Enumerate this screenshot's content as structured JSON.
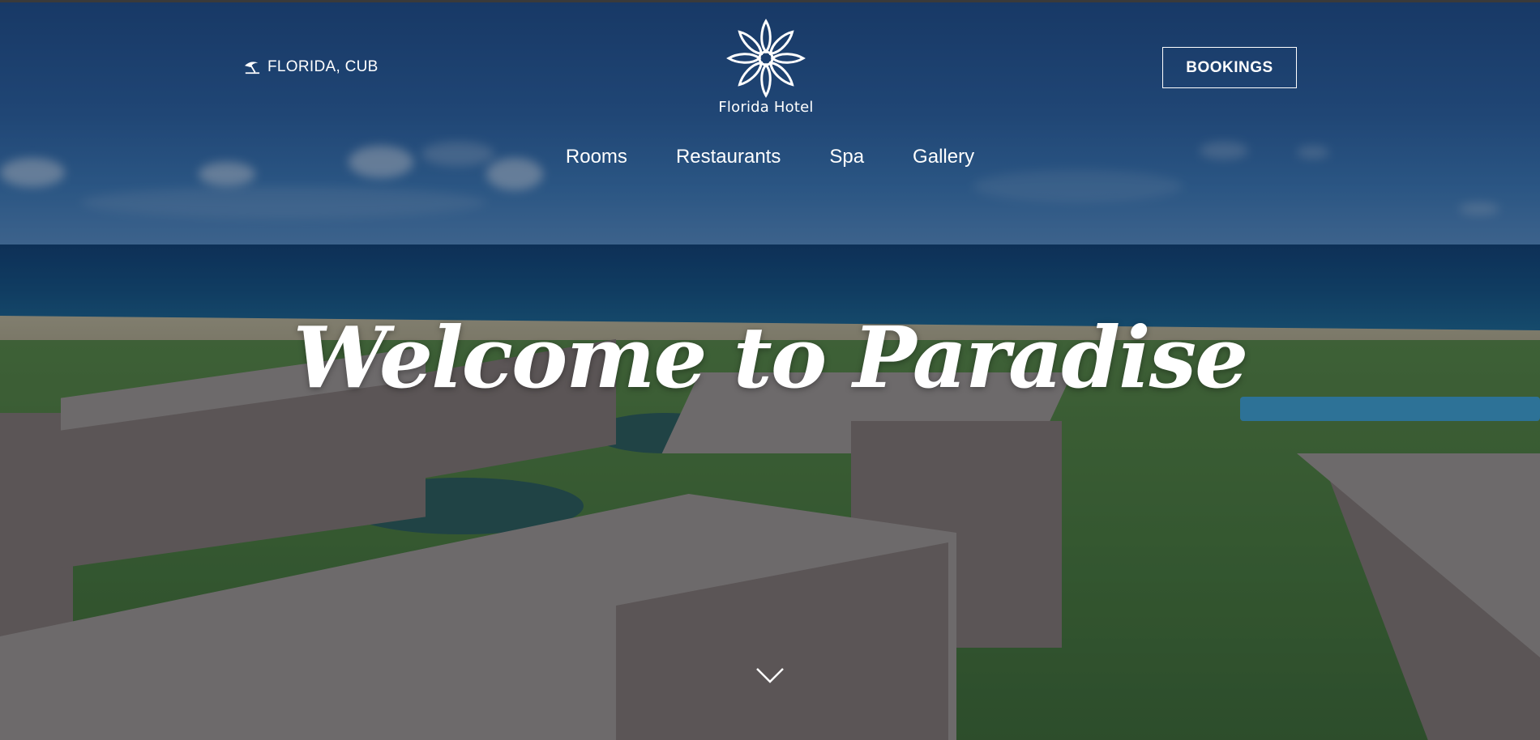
{
  "header": {
    "location": "FLORIDA, CUB",
    "logo_text": "Florida Hotel",
    "bookings_label": "BOOKINGS"
  },
  "nav": {
    "items": [
      {
        "label": "Rooms"
      },
      {
        "label": "Restaurants"
      },
      {
        "label": "Spa"
      },
      {
        "label": "Gallery"
      }
    ]
  },
  "hero": {
    "headline": "Welcome to Paradise"
  },
  "icons": {
    "location": "beach-umbrella-icon",
    "logo": "flower-logo-icon",
    "scroll": "chevron-down-icon"
  },
  "colors": {
    "text": "#ffffff",
    "overlay": "#0f1e32"
  }
}
